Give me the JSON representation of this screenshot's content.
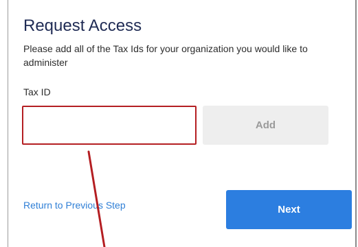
{
  "form": {
    "title": "Request Access",
    "subtitle": "Please add all of the Tax Ids for your organization you would like to administer",
    "tax_id_label": "Tax ID",
    "tax_id_value": "",
    "add_label": "Add",
    "back_link": "Return to Previous Step",
    "next_label": "Next"
  },
  "annotation": {
    "highlight_color": "#b41e22"
  },
  "colors": {
    "title": "#1f2b54",
    "link": "#2f7fd6",
    "primary_button": "#2c7ee0",
    "disabled_button": "#eeeeee"
  }
}
